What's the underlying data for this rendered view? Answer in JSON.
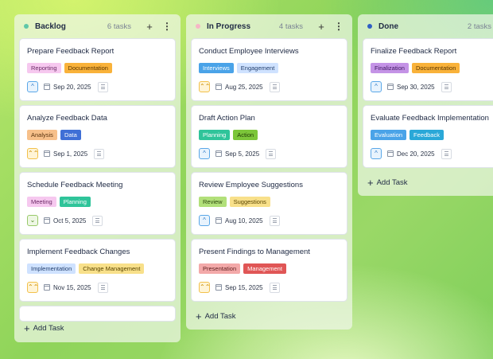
{
  "columns": [
    {
      "id": "backlog",
      "title": "Backlog",
      "count": "6 tasks",
      "dot_color": "#5fc7a8",
      "add_label": "Add Task",
      "cards": [
        {
          "title": "Prepare Feedback Report",
          "tags": [
            {
              "label": "Reporting",
              "bg": "#f6c8ef",
              "fg": "#6b2a66"
            },
            {
              "label": "Documentation",
              "bg": "#f9b23a",
              "fg": "#5a3500"
            }
          ],
          "priority": "low",
          "date": "Sep 20, 2025"
        },
        {
          "title": "Analyze Feedback Data",
          "tags": [
            {
              "label": "Analysis",
              "bg": "#f7c08a",
              "fg": "#5a3410"
            },
            {
              "label": "Data",
              "bg": "#3f6fd6",
              "fg": "#ffffff"
            }
          ],
          "priority": "high",
          "date": "Sep 1, 2025"
        },
        {
          "title": "Schedule Feedback Meeting",
          "tags": [
            {
              "label": "Meeting",
              "bg": "#f6c8ef",
              "fg": "#6b2a66"
            },
            {
              "label": "Planning",
              "bg": "#2fc49a",
              "fg": "#ffffff"
            }
          ],
          "priority": "lowest",
          "date": "Oct 5, 2025"
        },
        {
          "title": "Implement Feedback Changes",
          "tags": [
            {
              "label": "Implementation",
              "bg": "#cfe2ff",
              "fg": "#24406e"
            },
            {
              "label": "Change Management",
              "bg": "#f8e08a",
              "fg": "#5a4500"
            }
          ],
          "priority": "high",
          "date": "Nov 15, 2025"
        }
      ]
    },
    {
      "id": "progress",
      "title": "In Progress",
      "count": "4 tasks",
      "dot_color": "#f6b6c6",
      "add_label": "Add Task",
      "cards": [
        {
          "title": "Conduct Employee Interviews",
          "tags": [
            {
              "label": "Interviews",
              "bg": "#4aa3e8",
              "fg": "#ffffff"
            },
            {
              "label": "Engagement",
              "bg": "#cfe2ff",
              "fg": "#24406e"
            }
          ],
          "priority": "high",
          "date": "Aug 25, 2025"
        },
        {
          "title": "Draft Action Plan",
          "tags": [
            {
              "label": "Planning",
              "bg": "#2fc49a",
              "fg": "#ffffff"
            },
            {
              "label": "Action",
              "bg": "#7cc63a",
              "fg": "#1f3b05"
            }
          ],
          "priority": "low",
          "date": "Sep 5, 2025"
        },
        {
          "title": "Review Employee Suggestions",
          "tags": [
            {
              "label": "Review",
              "bg": "#b2e07a",
              "fg": "#2f4a10"
            },
            {
              "label": "Suggestions",
              "bg": "#f8e08a",
              "fg": "#5a4500"
            }
          ],
          "priority": "low",
          "date": "Aug 10, 2025"
        },
        {
          "title": "Present Findings to Management",
          "tags": [
            {
              "label": "Presentation",
              "bg": "#f3a9a9",
              "fg": "#5e1e1e"
            },
            {
              "label": "Management",
              "bg": "#e05656",
              "fg": "#ffffff"
            }
          ],
          "priority": "high",
          "date": "Sep 15, 2025"
        }
      ]
    },
    {
      "id": "done",
      "title": "Done",
      "count": "2 tasks",
      "dot_color": "#2f5fc4",
      "add_label": "Add Task",
      "cards": [
        {
          "title": "Finalize Feedback Report",
          "tags": [
            {
              "label": "Finalization",
              "bg": "#c493e6",
              "fg": "#3d1660"
            },
            {
              "label": "Documentation",
              "bg": "#f9b23a",
              "fg": "#5a3500"
            }
          ],
          "priority": "low",
          "date": "Sep 30, 2025"
        },
        {
          "title": "Evaluate Feedback Implementation",
          "tags": [
            {
              "label": "Evaluation",
              "bg": "#4aa3e8",
              "fg": "#ffffff"
            },
            {
              "label": "Feedback",
              "bg": "#2aa8d8",
              "fg": "#ffffff"
            }
          ],
          "priority": "low",
          "date": "Dec 20, 2025"
        }
      ]
    }
  ],
  "priority_styles": {
    "low": {
      "symbol": "^",
      "border": "#5aa7e8",
      "bg": "#e8f3fd",
      "fg": "#2f7bc8"
    },
    "high": {
      "symbol": "⌃⌃",
      "border": "#f2c14b",
      "bg": "#fff4d6",
      "fg": "#c98a00"
    },
    "lowest": {
      "symbol": "⌄",
      "border": "#98c96a",
      "bg": "#eef7e4",
      "fg": "#4f8a20"
    }
  }
}
